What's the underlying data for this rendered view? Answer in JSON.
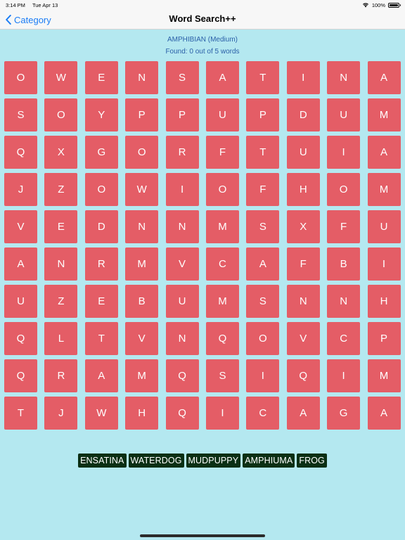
{
  "status": {
    "time": "3:14 PM",
    "date": "Tue Apr 13",
    "battery": "100%",
    "battery_level": 1.0
  },
  "nav": {
    "back_label": "Category",
    "title": "Word Search++"
  },
  "puzzle": {
    "name": "AMPHIBIAN (Medium)",
    "found": "Found: 0 out of 5 words"
  },
  "grid": [
    [
      "O",
      "W",
      "E",
      "N",
      "S",
      "A",
      "T",
      "I",
      "N",
      "A"
    ],
    [
      "S",
      "O",
      "Y",
      "P",
      "P",
      "U",
      "P",
      "D",
      "U",
      "M"
    ],
    [
      "Q",
      "X",
      "G",
      "O",
      "R",
      "F",
      "T",
      "U",
      "I",
      "A"
    ],
    [
      "J",
      "Z",
      "O",
      "W",
      "I",
      "O",
      "F",
      "H",
      "O",
      "M"
    ],
    [
      "V",
      "E",
      "D",
      "N",
      "N",
      "M",
      "S",
      "X",
      "F",
      "U"
    ],
    [
      "A",
      "N",
      "R",
      "M",
      "V",
      "C",
      "A",
      "F",
      "B",
      "I"
    ],
    [
      "U",
      "Z",
      "E",
      "B",
      "U",
      "M",
      "S",
      "N",
      "N",
      "H"
    ],
    [
      "Q",
      "L",
      "T",
      "V",
      "N",
      "Q",
      "O",
      "V",
      "C",
      "P"
    ],
    [
      "Q",
      "R",
      "A",
      "M",
      "Q",
      "S",
      "I",
      "Q",
      "I",
      "M"
    ],
    [
      "T",
      "J",
      "W",
      "H",
      "Q",
      "I",
      "C",
      "A",
      "G",
      "A"
    ]
  ],
  "words": [
    "ENSATINA",
    "WATERDOG",
    "MUDPUPPY",
    "AMPHIUMA",
    "FROG"
  ],
  "colors": {
    "background": "#b4e8f0",
    "cell": "#e45d66",
    "word_chip": "#0a2f14",
    "accent": "#1a7cf5"
  }
}
